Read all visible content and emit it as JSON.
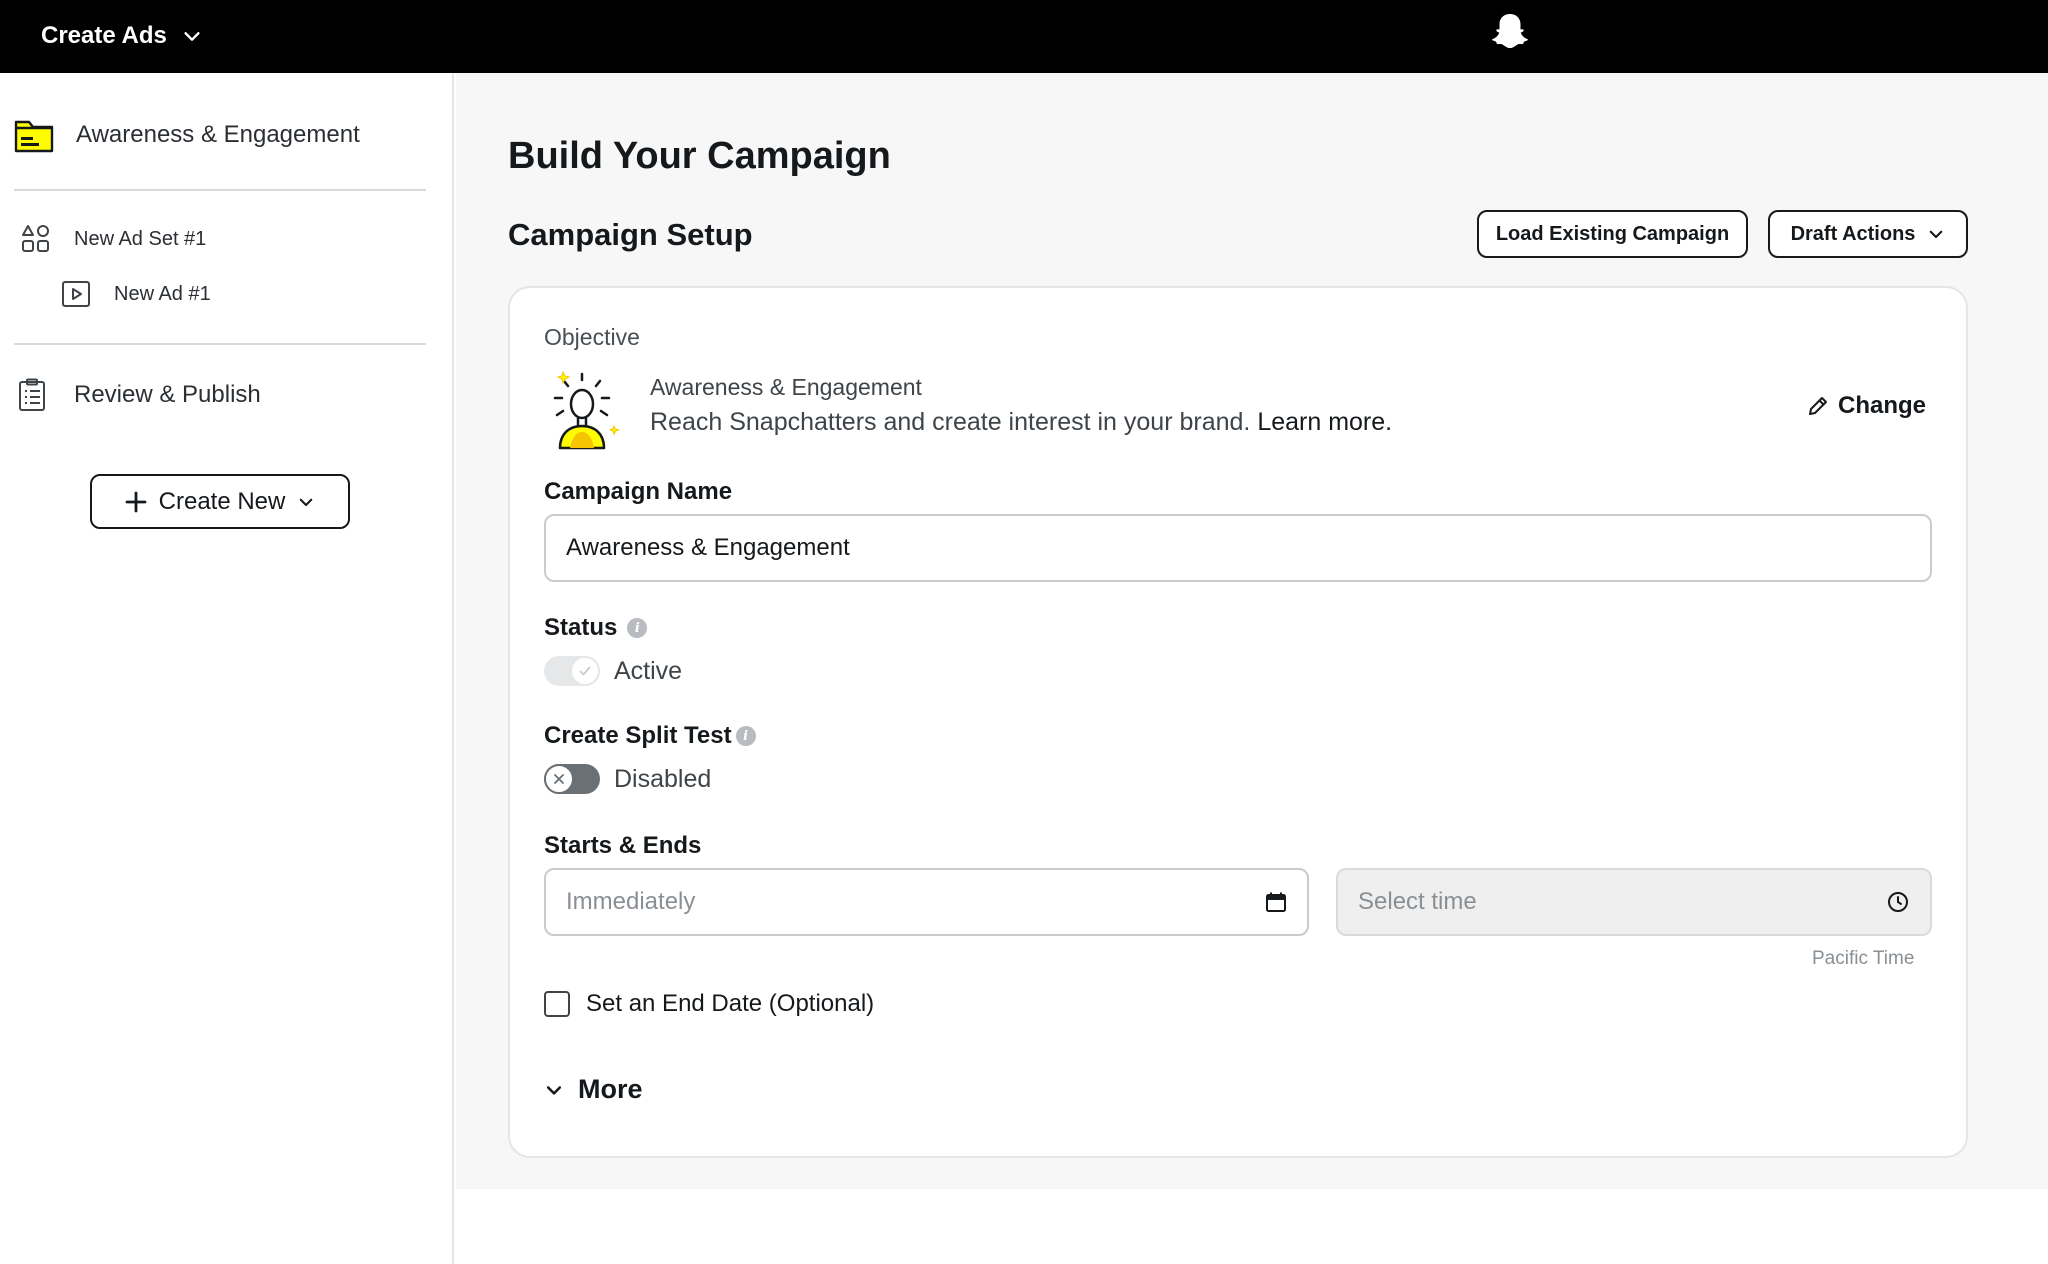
{
  "topbar": {
    "menu_label": "Create Ads"
  },
  "sidebar": {
    "campaign": "Awareness & Engagement",
    "ad_set": "New Ad Set #1",
    "ad": "New Ad #1",
    "review": "Review & Publish",
    "create_new": "Create New"
  },
  "main": {
    "page_title": "Build Your Campaign",
    "section_title": "Campaign Setup",
    "load_existing": "Load Existing Campaign",
    "draft_actions": "Draft Actions"
  },
  "card": {
    "objective_label": "Objective",
    "objective_name": "Awareness & Engagement",
    "objective_desc": "Reach Snapchatters and create interest in your brand.",
    "learn_more": "Learn more.",
    "change": "Change",
    "campaign_name_label": "Campaign Name",
    "campaign_name_value": "Awareness & Engagement",
    "status_label": "Status",
    "status_value": "Active",
    "split_test_label": "Create Split Test",
    "split_test_value": "Disabled",
    "starts_ends_label": "Starts & Ends",
    "start_date_placeholder": "Immediately",
    "time_placeholder": "Select time",
    "timezone": "Pacific Time",
    "end_date_label": "Set an End Date (Optional)",
    "more": "More"
  },
  "colors": {
    "brand_yellow": "#FFFC00",
    "accent_dark": "#16191C"
  }
}
